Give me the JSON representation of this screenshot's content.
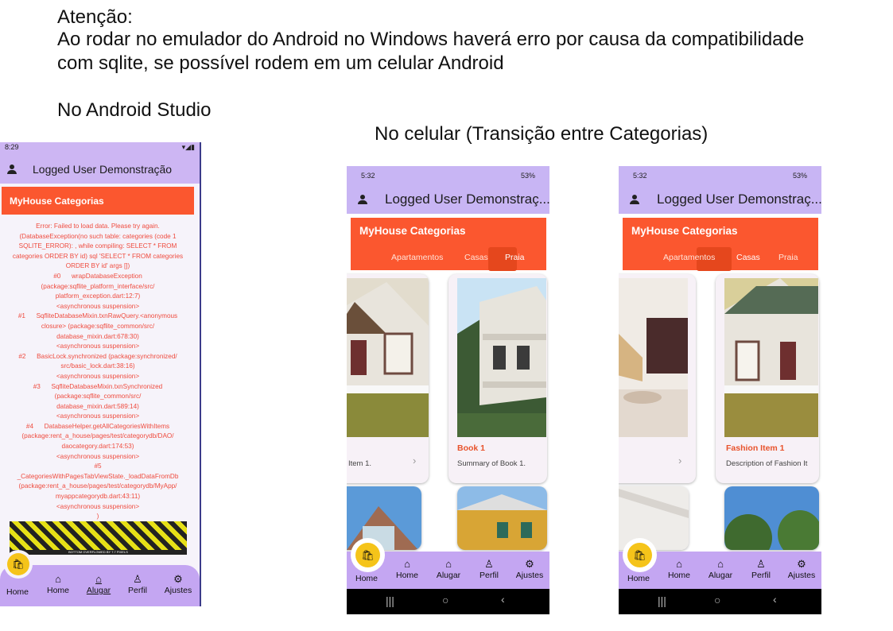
{
  "note": {
    "title": "Atenção:",
    "line1": "Ao rodar no emulador do Android no Windows haverá erro por causa da compatibilidade",
    "line2": "com sqlite, se possível rodem em um celular Android"
  },
  "captions": {
    "studio": "No Android Studio",
    "phone": "No celular  (Transição entre Categorias)"
  },
  "emulator": {
    "status_time": "8:29",
    "status_right": "▾◢▮",
    "user": "Logged User Demonstração",
    "category_bar": "MyHouse Categorias",
    "error_text": "Error: Failed to load data. Please try again.\n(DatabaseException(no such table: categories (code 1\nSQLITE_ERROR): , while compiling: SELECT * FROM\ncategories ORDER BY id) sql 'SELECT * FROM categories\nORDER BY id' args [])\n#0      wrapDatabaseException\n(package:sqflite_platform_interface/src/\nplatform_exception.dart:12:7)\n<asynchronous suspension>\n#1      SqfliteDatabaseMixin.txnRawQuery.<anonymous\nclosure> (package:sqflite_common/src/\ndatabase_mixin.dart:678:30)\n<asynchronous suspension>\n#2      BasicLock.synchronized (package:synchronized/\nsrc/basic_lock.dart:38:16)\n<asynchronous suspension>\n#3      SqfliteDatabaseMixin.txnSynchronized\n(package:sqflite_common/src/\ndatabase_mixin.dart:589:14)\n<asynchronous suspension>\n#4      DatabaseHelper.getAllCategoriesWithItems\n(package:rent_a_house/pages/test/categorydb/DAO/\ndaocategory.dart:174:53)\n<asynchronous suspension>\n#5\n_CategoriesWithPagesTabViewState._loadDataFromDb\n(package:rent_a_house/pages/test/categorydb/MyApp/\nmyappcategorydb.dart:43:11)\n<asynchronous suspension>\n)",
    "overflow_label": "BOTTOM OVERFLOWED BY 7.7 PIXELS",
    "nav": [
      "Home",
      "Home",
      "Alugar",
      "Perfil",
      "Ajustes"
    ]
  },
  "phone1": {
    "status_time": "5:32",
    "status_right": "53%",
    "user": "Logged User Demonstraç...",
    "category_bar": "MyHouse Categorias",
    "tabs": [
      "Apartamentos",
      "Casas",
      "Praia"
    ],
    "cards": [
      {
        "title": "",
        "summary": "Item 1."
      },
      {
        "title": "Book 1",
        "summary": "Summary of Book 1."
      }
    ],
    "nav": [
      "Home",
      "Home",
      "Alugar",
      "Perfil",
      "Ajustes"
    ]
  },
  "phone2": {
    "status_time": "5:32",
    "status_right": "53%",
    "user": "Logged User Demonstraç...",
    "category_bar": "MyHouse Categorias",
    "tabs": [
      "Apartamentos",
      "Casas",
      "Praia"
    ],
    "cards": [
      {
        "title": "",
        "summary": ""
      },
      {
        "title": "Fashion Item 1",
        "summary": "Description of Fashion It"
      }
    ],
    "nav": [
      "Home",
      "Home",
      "Alugar",
      "Perfil",
      "Ajustes"
    ]
  },
  "colors": {
    "orange": "#fb572f",
    "lavender": "#c8b5f4",
    "nav": "#c4a6f2",
    "fab": "#f5c41a"
  }
}
